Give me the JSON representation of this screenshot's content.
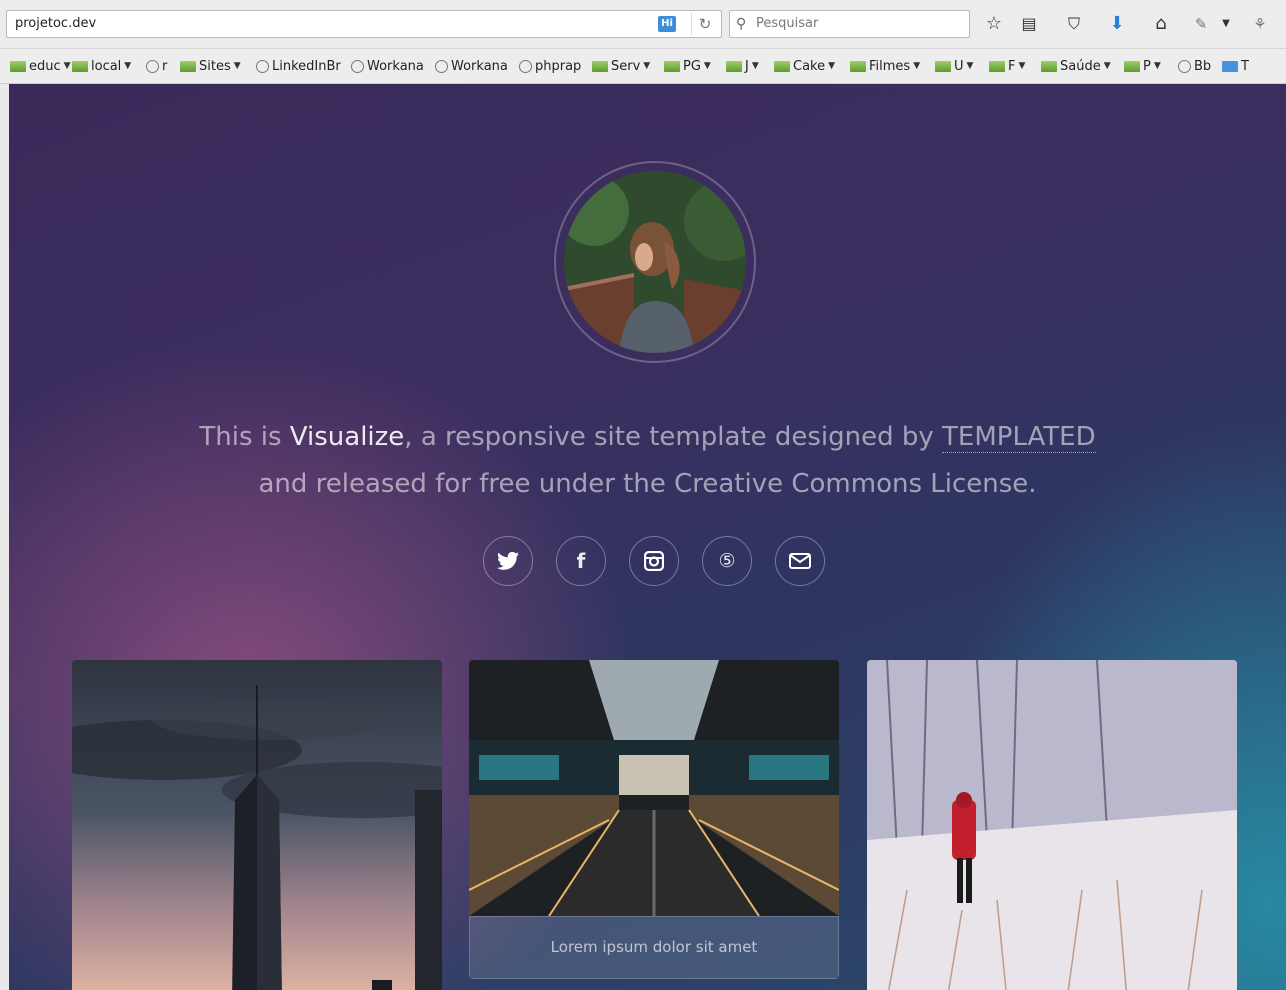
{
  "browser": {
    "url": "projetoc.dev",
    "badge": "Hi",
    "search_placeholder": "Pesquisar",
    "bookmarks": [
      {
        "label": "educ",
        "kind": "folder",
        "dropdown": true
      },
      {
        "label": "local",
        "kind": "folder",
        "dropdown": true
      },
      {
        "label": "r",
        "kind": "site",
        "dropdown": false
      },
      {
        "label": "Sites",
        "kind": "folder",
        "dropdown": true
      },
      {
        "label": "LinkedInBr",
        "kind": "site",
        "dropdown": false
      },
      {
        "label": "Workana",
        "kind": "site",
        "dropdown": false
      },
      {
        "label": "Workana",
        "kind": "site",
        "dropdown": false
      },
      {
        "label": "phprap",
        "kind": "site",
        "dropdown": false
      },
      {
        "label": "Serv",
        "kind": "folder",
        "dropdown": true
      },
      {
        "label": "PG",
        "kind": "folder",
        "dropdown": true
      },
      {
        "label": "J",
        "kind": "folder",
        "dropdown": true
      },
      {
        "label": "Cake",
        "kind": "folder",
        "dropdown": true
      },
      {
        "label": "Filmes",
        "kind": "folder",
        "dropdown": true
      },
      {
        "label": "U",
        "kind": "folder",
        "dropdown": true
      },
      {
        "label": "F",
        "kind": "folder",
        "dropdown": true
      },
      {
        "label": "Saúde",
        "kind": "folder",
        "dropdown": true
      },
      {
        "label": "P",
        "kind": "folder",
        "dropdown": true
      },
      {
        "label": "Bb",
        "kind": "site",
        "dropdown": false
      },
      {
        "label": "T",
        "kind": "translate",
        "dropdown": false
      }
    ]
  },
  "page": {
    "intro": {
      "p1": "This is ",
      "brand": "Visualize",
      "p2": ", a responsive site template designed by ",
      "link": "TEMPLATED",
      "line2": "and released for free under the Creative Commons License."
    },
    "socials": [
      "twitter-icon",
      "facebook-icon",
      "instagram-icon",
      "500px-icon",
      "envelope-icon"
    ],
    "cards": [
      {
        "name": "city-skyline",
        "caption": ""
      },
      {
        "name": "escalator-hall",
        "caption": "Lorem ipsum dolor sit amet"
      },
      {
        "name": "snowy-field",
        "caption": ""
      }
    ]
  },
  "colors": {
    "bg_purple": "#3b2e5f",
    "bg_pink": "#965082",
    "bg_teal": "#288ca5"
  }
}
